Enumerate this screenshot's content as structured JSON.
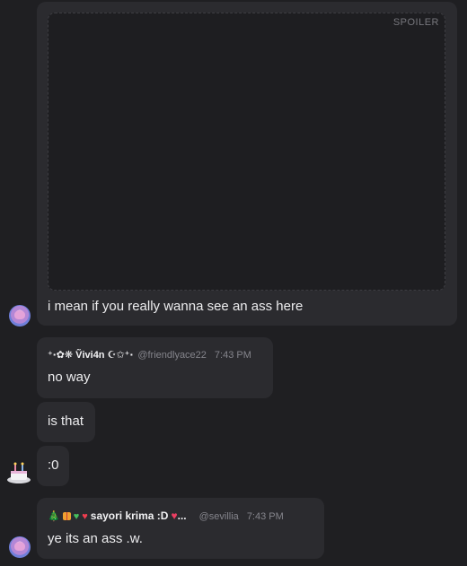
{
  "messages": {
    "spoiler_label": "SPOILER",
    "m1_text": "i mean if you really wanna see an ass here",
    "m2_name": "⁺‧✿❋ Ṽivi4n ☪✩⁺‧",
    "m2_handle": "@friendlyace22",
    "m2_time": "7:43 PM",
    "m2_text": "no way",
    "m3_text": "is that",
    "m4_text": ":0",
    "m5_name": "sayori krima :D",
    "m5_name_suffix": "...",
    "m5_handle": "@sevillia",
    "m5_time": "7:43 PM",
    "m5_text": "ye its an ass .w."
  },
  "icons": {
    "tree": "🎄",
    "heart_green": "♥",
    "heart_red": "♥",
    "heart_pink": "♥"
  },
  "colors": {
    "background": "#1f1f22",
    "bubble": "#2b2b2f",
    "spoiler_bg": "#1e1e21",
    "text": "#ececee",
    "muted": "#85858c"
  }
}
